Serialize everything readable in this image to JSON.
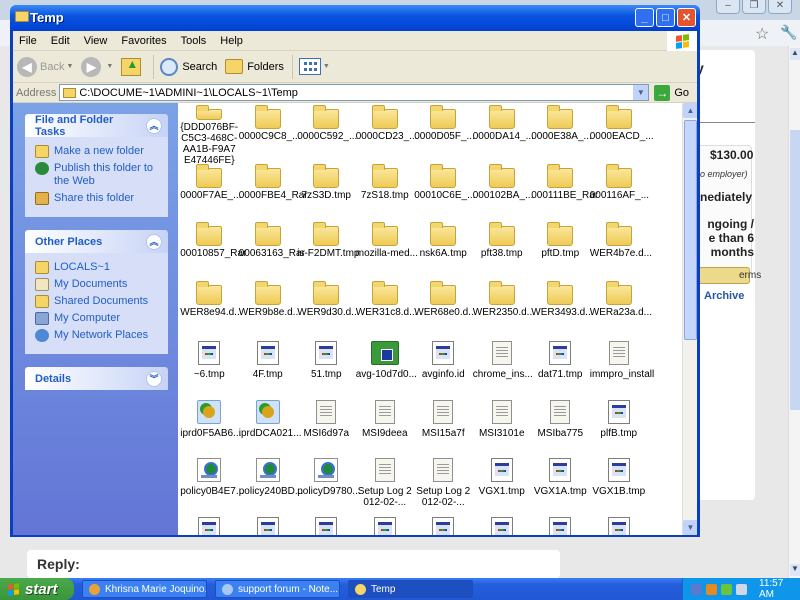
{
  "background_browser": {
    "window_controls": [
      "minimize",
      "restore",
      "close"
    ],
    "card": {
      "heading_fragment": "y",
      "price": "$130.00",
      "employer_note": "o employer)",
      "start": "nediately",
      "duration": "ngoing / e than 6 months",
      "terms_button": "erms",
      "archive_link": "Archive"
    },
    "reply_label": "Reply:"
  },
  "window": {
    "title": "Temp",
    "controls": {
      "minimize": "_",
      "maximize": "□",
      "close": "✕"
    },
    "menu": [
      "File",
      "Edit",
      "View",
      "Favorites",
      "Tools",
      "Help"
    ],
    "toolbar": {
      "back": "Back",
      "search": "Search",
      "folders": "Folders"
    },
    "address": {
      "label": "Address",
      "value": "C:\\DOCUME~1\\ADMINI~1\\LOCALS~1\\Temp",
      "go": "Go"
    }
  },
  "taskpane": {
    "file_tasks": {
      "title": "File and Folder Tasks",
      "items": [
        "Make a new folder",
        "Publish this folder to the Web",
        "Share this folder"
      ]
    },
    "other_places": {
      "title": "Other Places",
      "items": [
        "LOCALS~1",
        "My Documents",
        "Shared Documents",
        "My Computer",
        "My Network Places"
      ]
    },
    "details": {
      "title": "Details"
    }
  },
  "files": [
    {
      "name": "{DDD076BF-C5C3-468C-AA1B-F9A7E47446FE}",
      "type": "folder"
    },
    {
      "name": "0000C9C8_...",
      "type": "folder"
    },
    {
      "name": "0000C592_...",
      "type": "folder"
    },
    {
      "name": "0000CD23_...",
      "type": "folder"
    },
    {
      "name": "0000D05F_...",
      "type": "folder"
    },
    {
      "name": "0000DA14_...",
      "type": "folder"
    },
    {
      "name": "0000E38A_...",
      "type": "folder"
    },
    {
      "name": "0000EACD_...",
      "type": "folder"
    },
    {
      "name": "0000F7AE_...",
      "type": "folder"
    },
    {
      "name": "0000FBE4_Rar",
      "type": "folder"
    },
    {
      "name": "7zS3D.tmp",
      "type": "folder"
    },
    {
      "name": "7zS18.tmp",
      "type": "folder"
    },
    {
      "name": "00010C6E_...",
      "type": "folder"
    },
    {
      "name": "000102BA_...",
      "type": "folder"
    },
    {
      "name": "000111BE_Rar",
      "type": "folder"
    },
    {
      "name": "000116AF_...",
      "type": "folder"
    },
    {
      "name": "00010857_Rar",
      "type": "folder"
    },
    {
      "name": "00063163_Rar",
      "type": "folder"
    },
    {
      "name": "is-F2DMT.tmp",
      "type": "folder"
    },
    {
      "name": "mozilla-med...",
      "type": "folder"
    },
    {
      "name": "nsk6A.tmp",
      "type": "folder"
    },
    {
      "name": "pft38.tmp",
      "type": "folder"
    },
    {
      "name": "pftD.tmp",
      "type": "folder"
    },
    {
      "name": "WER4b7e.d...",
      "type": "folder"
    },
    {
      "name": "WER8e94.d...",
      "type": "folder"
    },
    {
      "name": "WER9b8e.d...",
      "type": "folder"
    },
    {
      "name": "WER9d30.d...",
      "type": "folder"
    },
    {
      "name": "WER31c8.d...",
      "type": "folder"
    },
    {
      "name": "WER68e0.d...",
      "type": "folder"
    },
    {
      "name": "WER2350.d...",
      "type": "folder"
    },
    {
      "name": "WER3493.d...",
      "type": "folder"
    },
    {
      "name": "WERa23a.d...",
      "type": "folder"
    },
    {
      "name": "~6.tmp",
      "type": "app"
    },
    {
      "name": "4F.tmp",
      "type": "app"
    },
    {
      "name": "51.tmp",
      "type": "app"
    },
    {
      "name": "avg-10d7d0...",
      "type": "avg"
    },
    {
      "name": "avginfo.id",
      "type": "app"
    },
    {
      "name": "chrome_ins...",
      "type": "text"
    },
    {
      "name": "dat71.tmp",
      "type": "app"
    },
    {
      "name": "immpro_install",
      "type": "text"
    },
    {
      "name": "iprd0F5AB6...",
      "type": "setup"
    },
    {
      "name": "iprdDCA021...",
      "type": "setup"
    },
    {
      "name": "MSI6d97a",
      "type": "text"
    },
    {
      "name": "MSI9deea",
      "type": "text"
    },
    {
      "name": "MSI15a7f",
      "type": "text"
    },
    {
      "name": "MSI3101e",
      "type": "text"
    },
    {
      "name": "MSIba775",
      "type": "text"
    },
    {
      "name": "plfB.tmp",
      "type": "app"
    },
    {
      "name": "policy0B4E7...",
      "type": "xml"
    },
    {
      "name": "policy240BD...",
      "type": "xml"
    },
    {
      "name": "policyD9780...",
      "type": "xml"
    },
    {
      "name": "Setup Log 2012-02-...",
      "type": "text"
    },
    {
      "name": "Setup Log 2012-02-...",
      "type": "text"
    },
    {
      "name": "VGX1.tmp",
      "type": "app"
    },
    {
      "name": "VGX1A.tmp",
      "type": "app"
    },
    {
      "name": "VGX1B.tmp",
      "type": "app"
    },
    {
      "name": "",
      "type": "app"
    },
    {
      "name": "",
      "type": "app"
    },
    {
      "name": "",
      "type": "app"
    },
    {
      "name": "",
      "type": "app"
    },
    {
      "name": "",
      "type": "app"
    },
    {
      "name": "",
      "type": "app"
    },
    {
      "name": "",
      "type": "app"
    },
    {
      "name": "",
      "type": "app"
    }
  ],
  "taskbar": {
    "start": "start",
    "tasks": [
      {
        "label": "Khrisna Marie Joquino...",
        "icon": "chrome-icon",
        "color": "#e8a23a"
      },
      {
        "label": "support forum - Note...",
        "icon": "notepad-icon",
        "color": "#a9c7f0"
      },
      {
        "label": "Temp",
        "icon": "folder-icon",
        "color": "#f5d468",
        "active": true
      }
    ],
    "tray_icons": [
      {
        "name": "network-icon",
        "color": "#5a7ad0"
      },
      {
        "name": "avast-icon",
        "color": "#e48a22"
      },
      {
        "name": "security-shield-icon",
        "color": "#6bc53c"
      },
      {
        "name": "sound-icon",
        "color": "#d0d8e8"
      }
    ],
    "clock": "11:57 AM"
  }
}
